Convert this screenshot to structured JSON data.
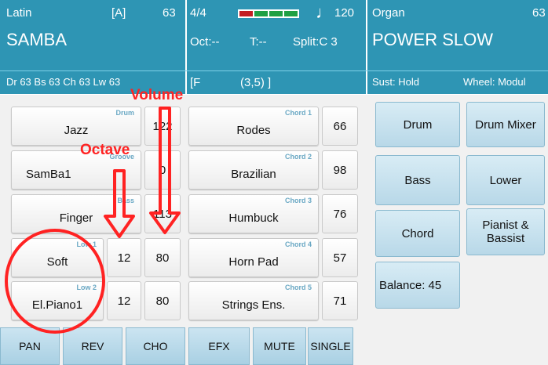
{
  "header": {
    "style_category": "Latin",
    "style_bank": "[A]",
    "style_number": "63",
    "style_name": "SAMBA",
    "style_voices": "Dr 63  Bs 63  Ch 63  Lw 63",
    "time_signature": "4/4",
    "tempo_note": "♩",
    "tempo": "120",
    "octave": "Oct:--",
    "transpose": "T:--",
    "split": "Split:C 3",
    "chord": "[F",
    "chord_extra": "(3,5) ]",
    "beat_indicator_colors": [
      "#c41e24",
      "#1fa043",
      "#1fa043",
      "#1fa043"
    ],
    "voice_category": "Organ",
    "voice_number": "63",
    "voice_name": "POWER SLOW",
    "sustain": "Sust: Hold",
    "wheel": "Wheel: Modul"
  },
  "left_parts": [
    {
      "tag": "Drum",
      "name": "Jazz",
      "octave": "",
      "volume": "122"
    },
    {
      "tag": "Groove",
      "name": "SamBa1",
      "octave": "",
      "volume": "0"
    },
    {
      "tag": "Bass",
      "name": "Finger",
      "octave": "",
      "volume": "113"
    },
    {
      "tag": "Low 1",
      "name": "Soft",
      "octave": "12",
      "volume": "80"
    },
    {
      "tag": "Low 2",
      "name": "El.Piano1",
      "octave": "12",
      "volume": "80"
    }
  ],
  "chord_parts": [
    {
      "tag": "Chord 1",
      "name": "Rodes",
      "volume": "66"
    },
    {
      "tag": "Chord 2",
      "name": "Brazilian",
      "volume": "98"
    },
    {
      "tag": "Chord 3",
      "name": "Humbuck",
      "volume": "76"
    },
    {
      "tag": "Chord 4",
      "name": "Horn Pad",
      "volume": "57"
    },
    {
      "tag": "Chord 5",
      "name": "Strings Ens.",
      "volume": "71"
    }
  ],
  "right_buttons": {
    "drum": "Drum",
    "drum_mixer": "Drum Mixer",
    "bass": "Bass",
    "lower": "Lower",
    "chord": "Chord",
    "pianist_bassist": "Pianist & Bassist",
    "balance": "Balance: 45"
  },
  "bottom_bar": [
    "PAN",
    "REV",
    "CHO",
    "EFX",
    "MUTE",
    "SINGLE"
  ],
  "annotations": {
    "volume": "Volume",
    "octave": "Octave",
    "color": "#ff2222"
  }
}
